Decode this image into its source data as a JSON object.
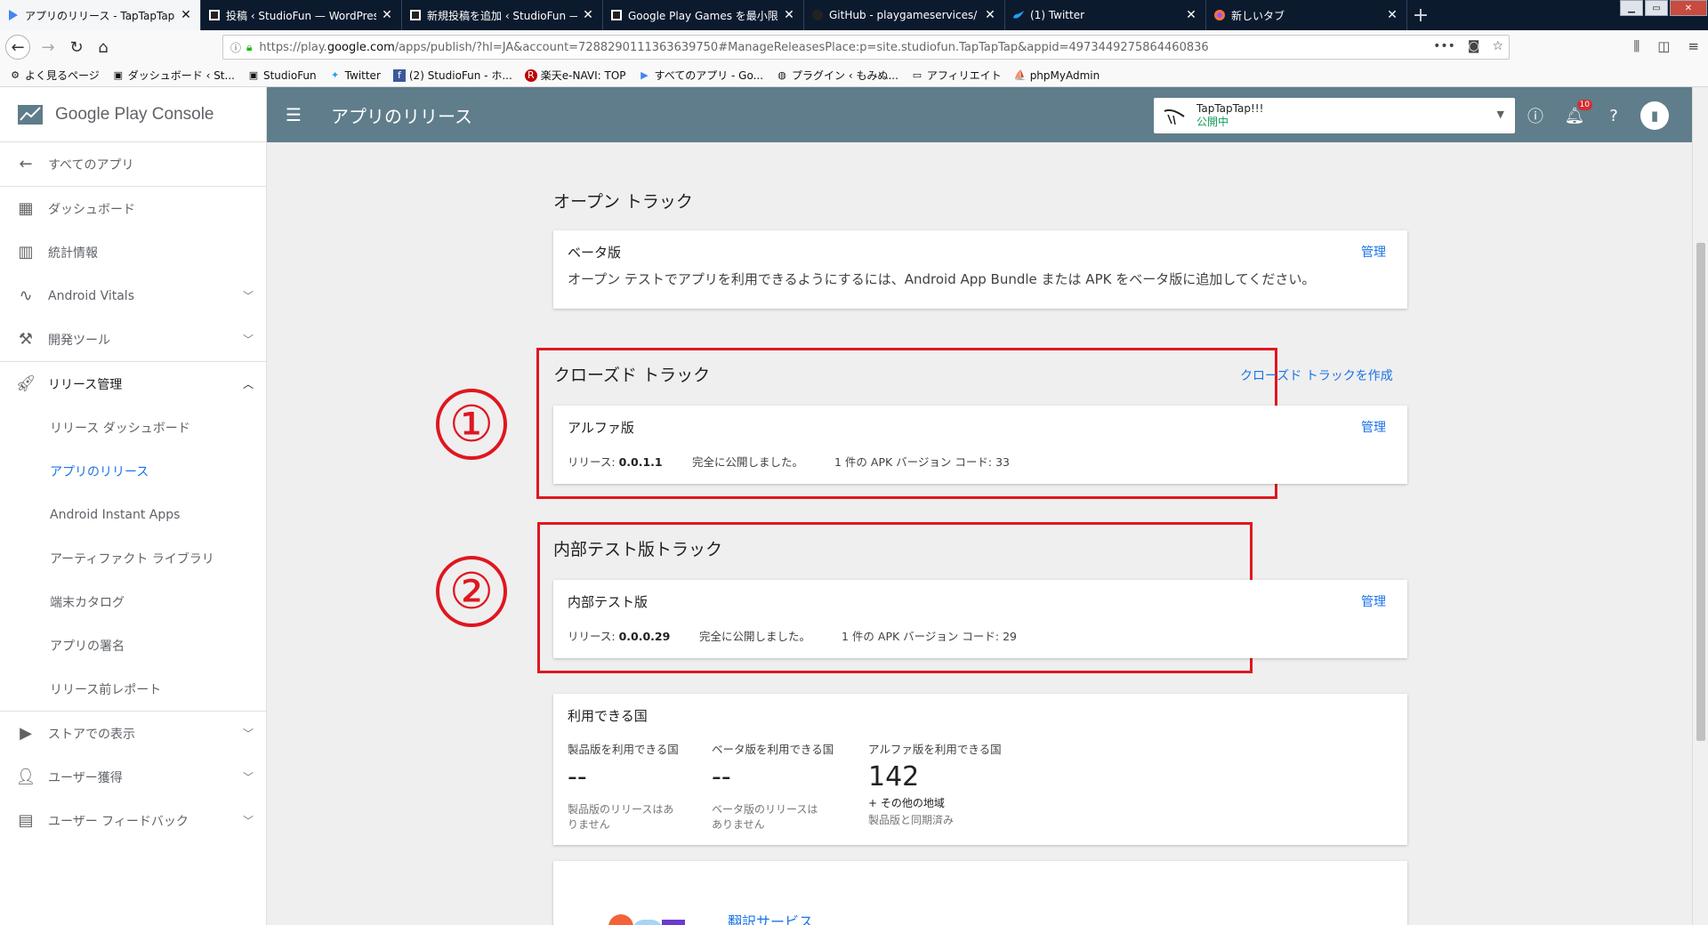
{
  "browser": {
    "tabs": [
      {
        "title": "アプリのリリース - TapTapTap!!!",
        "active": true,
        "icon": "play-console-icon"
      },
      {
        "title": "投稿 ‹ StudioFun — WordPress",
        "active": false,
        "icon": "studiofun-icon"
      },
      {
        "title": "新規投稿を追加 ‹ StudioFun — WordPress",
        "active": false,
        "icon": "studiofun-icon"
      },
      {
        "title": "Google Play Games を最小限の実装",
        "active": false,
        "icon": "studiofun-icon"
      },
      {
        "title": "GitHub - playgameservices/",
        "active": false,
        "icon": "github-icon"
      },
      {
        "title": "(1) Twitter",
        "active": false,
        "icon": "twitter-icon"
      },
      {
        "title": "新しいタブ",
        "active": false,
        "icon": "firefox-icon"
      }
    ],
    "url": {
      "prefix": "https://play.",
      "domain": "google.com",
      "rest": "/apps/publish/?hl=JA&account=7288290111363639750#ManageReleasesPlace:p=site.studiofun.TapTapTap&appid=4973449275864460836"
    },
    "bookmarks": [
      {
        "label": "よく見るページ",
        "icon": "gear-icon"
      },
      {
        "label": "ダッシュボード ‹ St...",
        "icon": "studiofun-icon"
      },
      {
        "label": "StudioFun",
        "icon": "studiofun-icon"
      },
      {
        "label": "Twitter",
        "icon": "twitter-icon"
      },
      {
        "label": "(2) StudioFun - ホ...",
        "icon": "facebook-icon"
      },
      {
        "label": "楽天e-NAVI: TOP",
        "icon": "rakuten-icon"
      },
      {
        "label": "すべてのアプリ - Go...",
        "icon": "play-console-icon"
      },
      {
        "label": "プラグイン ‹ もみぬ...",
        "icon": "globe-icon"
      },
      {
        "label": "アフィリエイト",
        "icon": "folder-icon"
      },
      {
        "label": "phpMyAdmin",
        "icon": "phpmyadmin-icon"
      }
    ]
  },
  "console": {
    "brand": "Google Play Console",
    "page_title": "アプリのリリース",
    "app_name": "TapTapTap!!!",
    "app_status": "公開中",
    "notification_count": "10",
    "sidebar": {
      "all_apps": "すべてのアプリ",
      "dashboard": "ダッシュボード",
      "stats": "統計情報",
      "vitals": "Android Vitals",
      "devtools": "開発ツール",
      "release_mgmt": "リリース管理",
      "release_dashboard": "リリース ダッシュボード",
      "app_releases": "アプリのリリース",
      "instant_apps": "Android Instant Apps",
      "artifact_library": "アーティファクト ライブラリ",
      "device_catalog": "端末カタログ",
      "app_signing": "アプリの署名",
      "prelaunch": "リリース前レポート",
      "store_listing": "ストアでの表示",
      "user_acquisition": "ユーザー獲得",
      "user_feedback": "ユーザー フィードバック"
    }
  },
  "main": {
    "open_track": {
      "title": "オープン トラック",
      "card_title": "ベータ版",
      "manage": "管理",
      "description": "オープン テストでアプリを利用できるようにするには、Android App Bundle または APK をベータ版に追加してください。"
    },
    "closed_track": {
      "title": "クローズド トラック",
      "create_link": "クローズド トラックを作成",
      "annotation": "①",
      "card_title": "アルファ版",
      "manage": "管理",
      "release_label": "リリース: ",
      "release_version": "0.0.1.1",
      "status": "完全に公開しました。",
      "apk_info": "1 件の APK バージョン コード: 33"
    },
    "internal_track": {
      "title": "内部テスト版トラック",
      "annotation": "②",
      "card_title": "内部テスト版",
      "manage": "管理",
      "release_label": "リリース: ",
      "release_version": "0.0.0.29",
      "status": "完全に公開しました。",
      "apk_info": "1 件の APK バージョン コード: 29"
    },
    "countries": {
      "title": "利用できる国",
      "production_label": "製品版を利用できる国",
      "production_value": "--",
      "production_note_1": "製品版のリリースはあ",
      "production_note_2": "りません",
      "beta_label": "ベータ版を利用できる国",
      "beta_value": "--",
      "beta_note_1": "ベータ版のリリースは",
      "beta_note_2": "ありません",
      "alpha_label": "アルファ版を利用できる国",
      "alpha_value": "142",
      "alpha_plus": "+ その他の地域",
      "alpha_note": "製品版と同期済み"
    },
    "translation": {
      "link": "翻訳サービス"
    }
  },
  "colors": {
    "topbar": "#607d8b",
    "link": "#1a73e8",
    "annotation_red": "#e0161f",
    "status_green": "#0f9d58"
  }
}
